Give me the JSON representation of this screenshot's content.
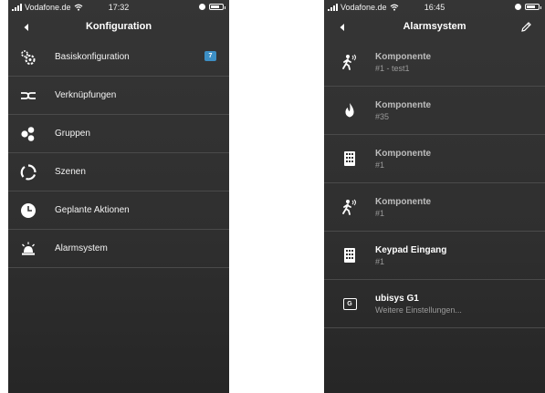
{
  "left_screen": {
    "status": {
      "carrier": "Vodafone.de",
      "time": "17:32"
    },
    "nav": {
      "title": "Konfiguration"
    },
    "items": [
      {
        "label": "Basiskonfiguration",
        "icon": "gears-icon",
        "badge": "7"
      },
      {
        "label": "Verknüpfungen",
        "icon": "link-icon"
      },
      {
        "label": "Gruppen",
        "icon": "group-icon"
      },
      {
        "label": "Szenen",
        "icon": "scene-cycle-icon"
      },
      {
        "label": "Geplante Aktionen",
        "icon": "clock-icon"
      },
      {
        "label": "Alarmsystem",
        "icon": "alarm-siren-icon"
      }
    ]
  },
  "right_screen": {
    "status": {
      "carrier": "Vodafone.de",
      "time": "16:45"
    },
    "nav": {
      "title": "Alarmsystem"
    },
    "items": [
      {
        "name": "Komponente",
        "sub": "#1 - test1",
        "icon": "motion-sensor-icon"
      },
      {
        "name": "Komponente",
        "sub": "#35",
        "icon": "fire-icon"
      },
      {
        "name": "Komponente",
        "sub": "#1",
        "icon": "keypad-icon"
      },
      {
        "name": "Komponente",
        "sub": "#1",
        "icon": "motion-sensor-icon"
      },
      {
        "name": "Keypad Eingang",
        "sub": "#1",
        "icon": "keypad-icon"
      },
      {
        "name": "ubisys G1",
        "sub": "Weitere Einstellungen...",
        "icon": "gateway-g-icon",
        "icon_text": "G"
      }
    ]
  }
}
